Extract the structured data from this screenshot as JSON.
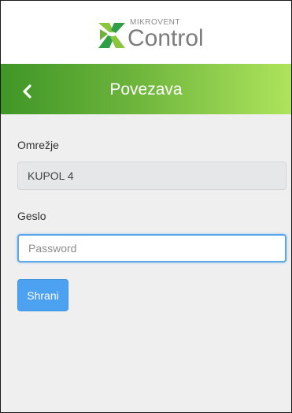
{
  "brand": {
    "small_text": "MIKROVENT",
    "large_text": "Control",
    "logo_colors": [
      "#8ac53f",
      "#2f9e47"
    ]
  },
  "nav": {
    "title": "Povezava",
    "back_icon": "chevron-left-icon",
    "gradient": [
      "#3f9627",
      "#aee45c"
    ]
  },
  "form": {
    "network_label": "Omrežje",
    "network_value": "KUPOL 4",
    "password_label": "Geslo",
    "password_placeholder": "Password",
    "password_value": "",
    "save_label": "Shrani",
    "accent": "#4ca1f1"
  }
}
